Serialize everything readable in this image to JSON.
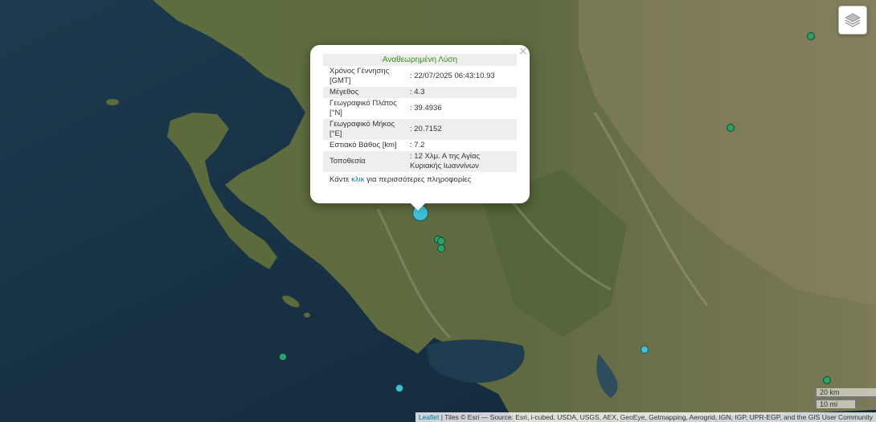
{
  "map": {
    "layers_control_icon": "layers-icon",
    "markers": [
      {
        "name": "quake-marker",
        "color": "#2aa36a",
        "size": "small"
      },
      {
        "name": "quake-marker",
        "color": "#2aa36a",
        "size": "small"
      },
      {
        "name": "quake-marker",
        "color": "#2aa36a",
        "size": "small"
      },
      {
        "name": "quake-marker",
        "color": "#2aa36a",
        "size": "small"
      },
      {
        "name": "quake-marker",
        "color": "#2aa36a",
        "size": "small"
      },
      {
        "name": "quake-marker",
        "color": "#2aa36a",
        "size": "small"
      },
      {
        "name": "quake-marker",
        "color": "#2aa36a",
        "size": "small"
      },
      {
        "name": "quake-marker",
        "color": "#3fc3d6",
        "size": "small"
      },
      {
        "name": "quake-marker",
        "color": "#3fc3d6",
        "size": "small"
      },
      {
        "name": "selected-quake-marker",
        "color": "#3fc3d6",
        "size": "large"
      }
    ]
  },
  "popup": {
    "close": "×",
    "title": "Αναθεωρημένη Λύση",
    "title_color": "#3a8a1f",
    "rows": [
      {
        "key": "Χρόνος Γέννησης [GMT]",
        "value": ": 22/07/2025 06:43:10.93"
      },
      {
        "key": "Μέγεθος",
        "value": ": 4.3"
      },
      {
        "key": "Γεωγραφικό Πλάτος [°N]",
        "value": ": 39.4936"
      },
      {
        "key": "Γεωγραφικό Μήκος [°E]",
        "value": ": 20.7152"
      },
      {
        "key": "Εστιακό Βάθος [km]",
        "value": ": 7.2"
      },
      {
        "key": "Τοποθεσία",
        "value": ": 12 Χλμ. Α της Αγίας Κυριακής Ιωαννίνων"
      }
    ],
    "more_prefix": "Κάντε ",
    "more_link": "κλικ",
    "more_suffix": " για περισσότερες πληροφορίες"
  },
  "scale": {
    "km": "20 km",
    "mi": "10 mi"
  },
  "attribution": {
    "leaflet": "Leaflet",
    "text": " | Tiles © Esri — Source: Esri, i-cubed, USDA, USGS, AEX, GeoEye, Getmapping, Aerogrid, IGN, IGP, UPR-EGP, and the GIS User Community"
  }
}
